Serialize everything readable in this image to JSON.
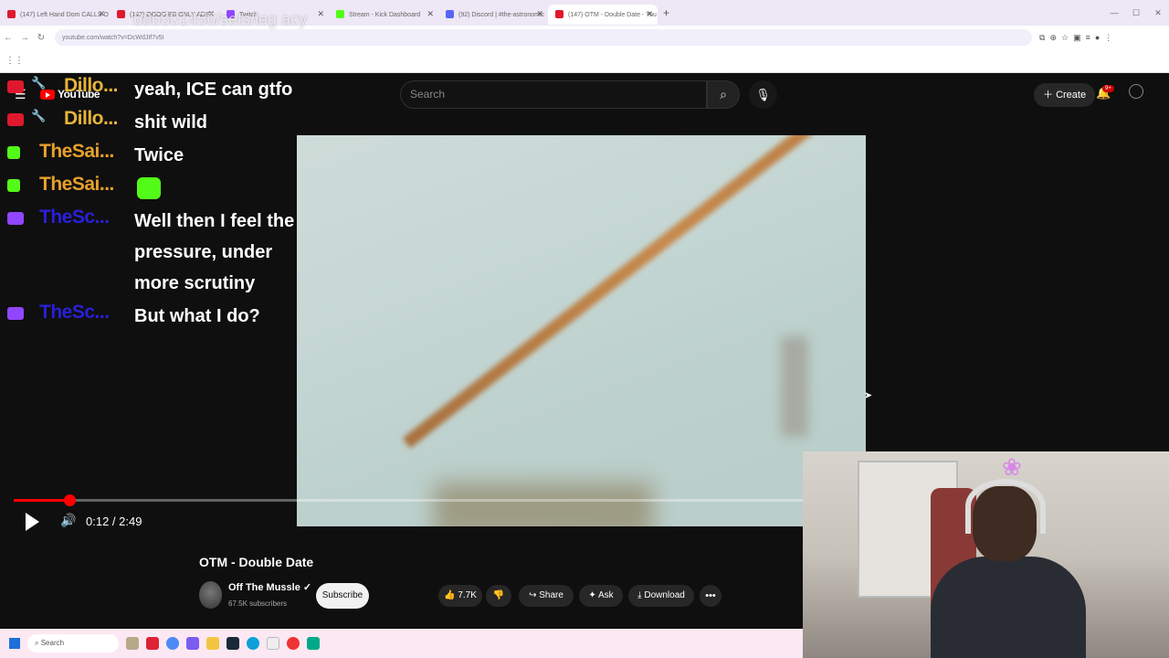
{
  "browser": {
    "tabs": [
      {
        "label": "(147) Left Hand Dom CALLS O",
        "color": "#e0182d"
      },
      {
        "label": "(147) OOOO EB ONLY ADS",
        "color": "#e0182d"
      },
      {
        "label": "Twitch",
        "color": "#9146ff"
      },
      {
        "label": "Stream - Kick Dashboard",
        "color": "#53fc18"
      },
      {
        "label": "(92) Discord | #the-astronomic",
        "color": "#5865f2"
      },
      {
        "label": "(147) OTM - Double Date - You",
        "color": "#e0182d"
      }
    ],
    "url": "youtube.com/watch?v=DcWdJIf7v5I",
    "overlay_text": "686501456/sets/leg acy"
  },
  "youtube": {
    "logo": "YouTube",
    "search_placeholder": "Search",
    "create_label": "Create",
    "notif_badge": "9+"
  },
  "chat": [
    {
      "platform": "youtube",
      "user": "Dillo...",
      "user_color": "#e6b43a",
      "message": "yeah, ICE can gtfo"
    },
    {
      "platform": "youtube",
      "user": "Dillo...",
      "user_color": "#e6b43a",
      "message": "shit wild"
    },
    {
      "platform": "kick",
      "user": "TheSai...",
      "user_color": "#e6a02a",
      "message": "Twice"
    },
    {
      "platform": "kick",
      "user": "TheSai...",
      "user_color": "#e6a02a",
      "message": ""
    },
    {
      "platform": "twitch",
      "user": "TheSc...",
      "user_color": "#2a1fd8",
      "message": "Well then I feel the pressure, under more scrutiny"
    },
    {
      "platform": "twitch",
      "user": "TheSc...",
      "user_color": "#2a1fd8",
      "message": "But what I do?"
    }
  ],
  "player": {
    "time": "0:12 / 2:49",
    "progress": 0.071
  },
  "video": {
    "title": "OTM - Double Date",
    "channel": "Off The Mussle",
    "subscribers": "67.5K subscribers",
    "subscribe_label": "Subscribe",
    "likes": "7.7K",
    "share_label": "Share",
    "ask_label": "Ask",
    "download_label": "Download"
  },
  "taskbar": {
    "search_placeholder": "Search"
  }
}
